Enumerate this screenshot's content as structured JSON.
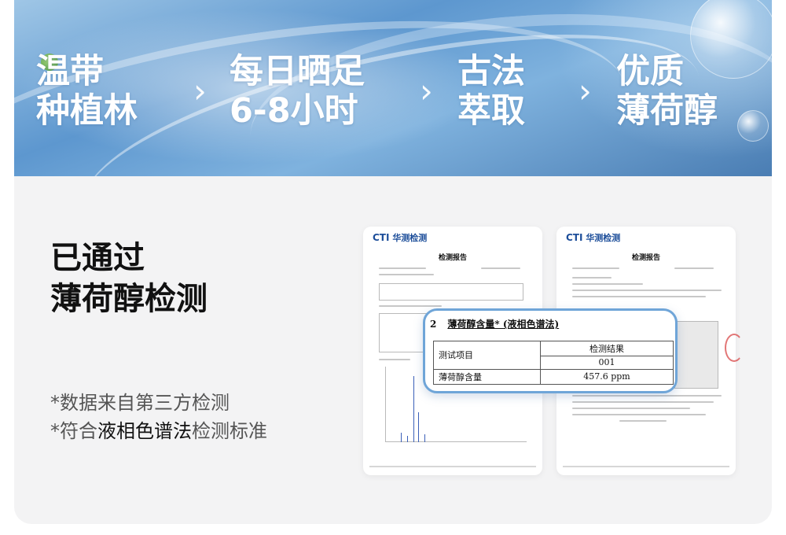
{
  "banner": {
    "features": [
      "温带\n种植林",
      "每日晒足\n6-8小时",
      "古法\n萃取",
      "优质\n薄荷醇"
    ],
    "arrow_glyph": "›"
  },
  "headline": {
    "line1": "已通过",
    "line2": "薄荷醇检测"
  },
  "notes": {
    "line1": "*数据来自第三方检测",
    "line2_prefix": "*符合",
    "line2_highlight": "液相色谱法",
    "line2_suffix": "检测标准"
  },
  "reports": [
    {
      "logo_mark": "CTI",
      "logo_text": "华测检测",
      "title": "检测报告"
    },
    {
      "logo_mark": "CTI",
      "logo_text": "华测检测",
      "title": "检测报告"
    }
  ],
  "zoom": {
    "section_number": "2",
    "section_title": "薄荷醇含量* (液相色谱法)",
    "col_item": "测试项目",
    "col_result": "检测结果",
    "sample_id": "001",
    "row_label": "薄荷醇含量",
    "row_value": "457.6 ppm"
  },
  "colors": {
    "accent_border": "#6fa5d8",
    "logo_blue": "#1d4e9a",
    "logo_red": "#d9342b"
  }
}
